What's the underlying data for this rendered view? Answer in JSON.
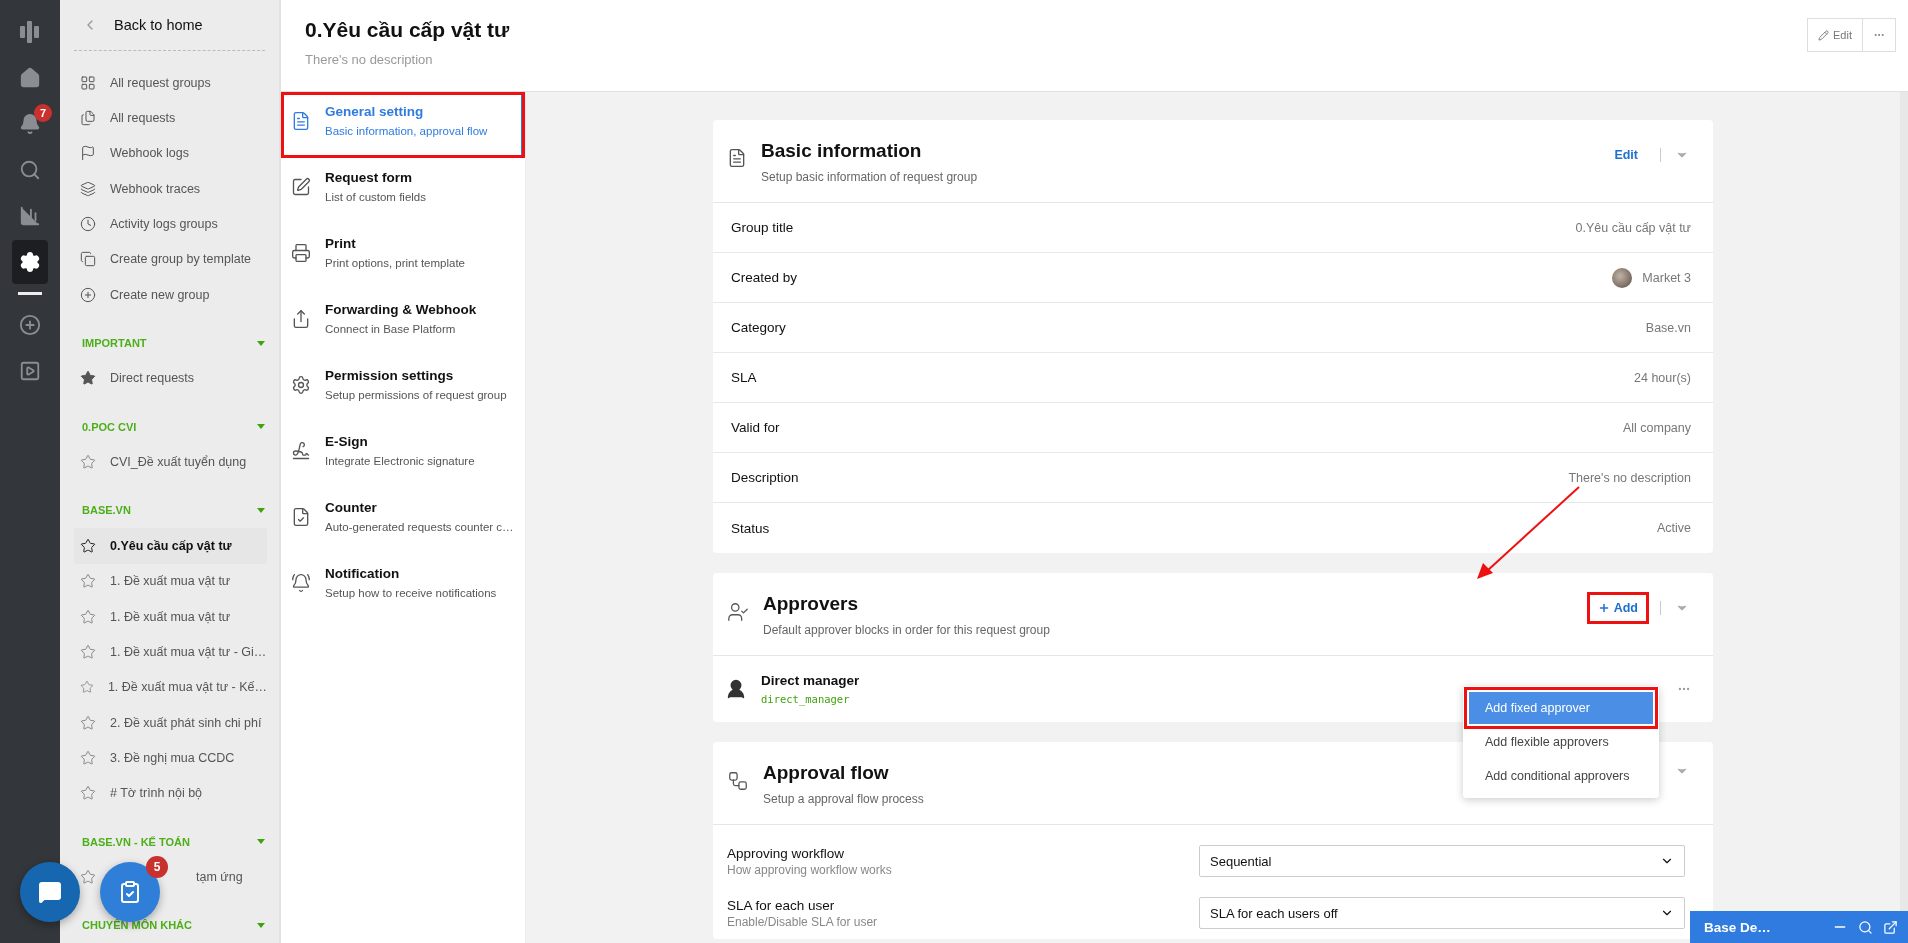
{
  "rail": [
    {
      "kind": "logo",
      "selected": false
    },
    {
      "kind": "home",
      "selected": false
    },
    {
      "kind": "bell",
      "selected": false,
      "badge": "7"
    },
    {
      "kind": "search",
      "selected": false
    },
    {
      "kind": "chart",
      "selected": false
    },
    {
      "kind": "settings",
      "selected": true
    },
    {
      "kind": "divider"
    },
    {
      "kind": "add",
      "selected": false
    },
    {
      "kind": "video",
      "selected": false
    }
  ],
  "sidebar": {
    "back": "Back to home",
    "links": [
      {
        "kind": "grid",
        "label": "All request groups"
      },
      {
        "kind": "files",
        "label": "All requests"
      },
      {
        "kind": "flag",
        "label": "Webhook logs"
      },
      {
        "kind": "layers",
        "label": "Webhook traces"
      },
      {
        "kind": "clock",
        "label": "Activity logs groups"
      },
      {
        "kind": "copy",
        "label": "Create group by template"
      },
      {
        "kind": "add",
        "label": "Create new group"
      }
    ],
    "sections": [
      {
        "title": "IMPORTANT",
        "items": [
          {
            "label": "Direct requests",
            "starred": true,
            "selected": false
          }
        ]
      },
      {
        "title": "0.POC CVI",
        "items": [
          {
            "label": "CVI_Đề xuất tuyển dụng",
            "starred": false,
            "selected": false
          }
        ]
      },
      {
        "title": "BASE.VN",
        "items": [
          {
            "label": "0.Yêu cầu cấp vật tư",
            "starred": false,
            "selected": true
          },
          {
            "label": "1. Đề xuất mua vật tư",
            "starred": false,
            "selected": false
          },
          {
            "label": "1. Đề xuất mua vật tư",
            "starred": false,
            "selected": false
          },
          {
            "label": "1. Đề xuất mua vật tư - Gi…",
            "starred": false,
            "selected": false
          },
          {
            "label": "1. Đề xuất mua vật tư - Kế…",
            "starred": false,
            "selected": false
          },
          {
            "label": "2. Đề xuất phát sinh chi phí",
            "starred": false,
            "selected": false
          },
          {
            "label": "3. Đề nghị mua CCDC",
            "starred": false,
            "selected": false
          },
          {
            "label": "# Tờ trình nội bộ",
            "starred": false,
            "selected": false
          }
        ]
      },
      {
        "title": "BASE.VN - KẾ TOÁN",
        "items": [
          {
            "label": "tạm ứng",
            "starred": false,
            "selected": false,
            "kind": "partial"
          }
        ]
      },
      {
        "title": "CHUYÊN MÔN KHÁC"
      }
    ]
  },
  "header": {
    "title": "0.Yêu cầu cấp vật tư",
    "description": "There's no description",
    "edit_button": "Edit"
  },
  "settings_nav": [
    {
      "kind": "document",
      "title": "General setting",
      "subtitle": "Basic information, approval flow",
      "selected": true,
      "highlighted": true
    },
    {
      "kind": "edit",
      "title": "Request form",
      "subtitle": "List of custom fields",
      "selected": false,
      "highlighted": false
    },
    {
      "kind": "print",
      "title": "Print",
      "subtitle": "Print options, print template",
      "selected": false,
      "highlighted": false
    },
    {
      "kind": "share",
      "title": "Forwarding & Webhook",
      "subtitle": "Connect in Base Platform",
      "selected": false,
      "highlighted": false
    },
    {
      "kind": "permission",
      "title": "Permission settings",
      "subtitle": "Setup permissions of request group",
      "selected": false,
      "highlighted": false
    },
    {
      "kind": "sign",
      "title": "E-Sign",
      "subtitle": "Integrate Electronic signature",
      "selected": false,
      "highlighted": false
    },
    {
      "kind": "counter",
      "title": "Counter",
      "subtitle": "Auto-generated requests counter c…",
      "selected": false,
      "highlighted": false
    },
    {
      "kind": "notification",
      "title": "Notification",
      "subtitle": "Setup how to receive notifications",
      "selected": false,
      "highlighted": false
    }
  ],
  "basic_info": {
    "title": "Basic information",
    "subtitle": "Setup basic information of request group",
    "edit_link": "Edit",
    "rows": [
      {
        "label": "Group title",
        "value": "0.Yêu cầu cấp vật tư"
      },
      {
        "label": "Created by",
        "value": "Market 3",
        "kind": "user"
      },
      {
        "label": "Category",
        "value": "Base.vn"
      },
      {
        "label": "SLA",
        "value": "24 hour(s)"
      },
      {
        "label": "Valid for",
        "value": "All company"
      },
      {
        "label": "Description",
        "value": "There's no description"
      },
      {
        "label": "Status",
        "value": "Active"
      }
    ]
  },
  "approvers": {
    "title": "Approvers",
    "subtitle": "Default approver blocks in order for this request group",
    "add_button": "Add",
    "add_highlighted": true,
    "items": [
      {
        "name": "Direct manager",
        "code": "direct_manager"
      }
    ],
    "menu": [
      {
        "label": "Add fixed approver",
        "selected": true,
        "highlighted": true
      },
      {
        "label": "Add flexible approvers",
        "selected": false,
        "highlighted": false
      },
      {
        "label": "Add conditional approvers",
        "selected": false,
        "highlighted": false
      }
    ]
  },
  "approval_flow": {
    "title": "Approval flow",
    "subtitle": "Setup a approval flow process",
    "fields": [
      {
        "label": "Approving workflow",
        "hint": "How approving workflow works",
        "value": "Sequential"
      },
      {
        "label": "SLA for each user",
        "hint": "Enable/Disable SLA for user",
        "value": "SLA for each users off"
      }
    ]
  },
  "task_button": {
    "badge": "5"
  },
  "chat_widget": {
    "title": "Base De…"
  }
}
